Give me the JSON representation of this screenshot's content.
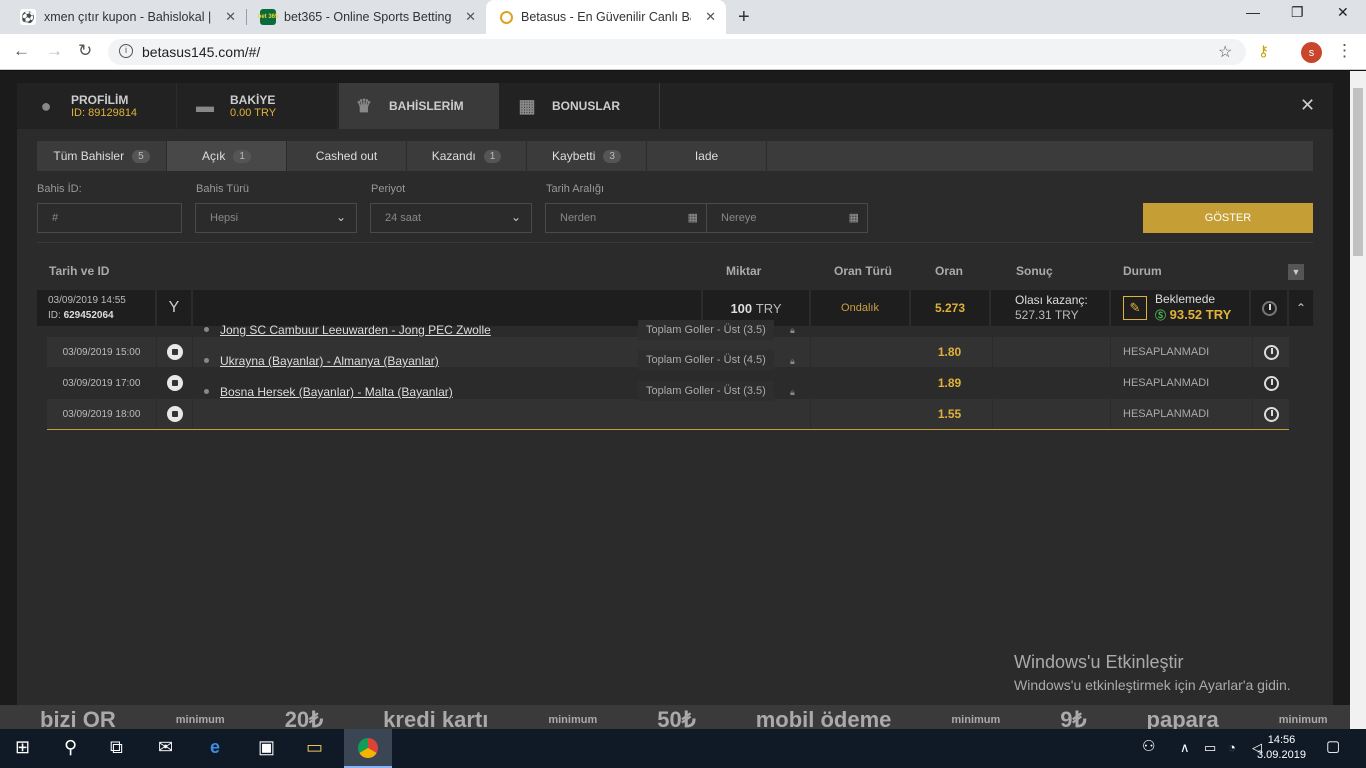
{
  "browser": {
    "tabs": [
      {
        "title": "xmen çıtır kupon - Bahislokal | Ba",
        "icon": "soccer-ball-icon"
      },
      {
        "title": "bet365 - Online Sports Betting",
        "icon": "bet365-icon",
        "badge": "bet 365"
      },
      {
        "title": "Betasus - En Güvenilir Canlı Bahis",
        "icon": "betasus-icon",
        "active": true
      }
    ],
    "url": "betasus145.com/#/",
    "avatar_letter": "s"
  },
  "modal": {
    "tabs": {
      "profile": {
        "label": "PROFİLİM",
        "sub": "ID: 89129814"
      },
      "balance": {
        "label": "BAKİYE",
        "sub": "0.00 TRY"
      },
      "bets": {
        "label": "BAHİSLERİM"
      },
      "bonus": {
        "label": "BONUSLAR"
      }
    },
    "filter_tabs": [
      {
        "label": "Tüm Bahisler",
        "count": "5"
      },
      {
        "label": "Açık",
        "count": "1"
      },
      {
        "label": "Cashed out",
        "count": ""
      },
      {
        "label": "Kazandı",
        "count": "1"
      },
      {
        "label": "Kaybetti",
        "count": "3"
      },
      {
        "label": "Iade",
        "count": ""
      }
    ],
    "filters": {
      "bet_id_label": "Bahis İD:",
      "bet_id_placeholder": "#",
      "bet_type_label": "Bahis Türü",
      "bet_type_value": "Hepsi",
      "period_label": "Periyot",
      "period_value": "24 saat",
      "date_range_label": "Tarih Aralığı",
      "from_placeholder": "Nerden",
      "to_placeholder": "Nereye",
      "show_button": "GÖSTER"
    },
    "table": {
      "headers": {
        "date_id": "Tarih ve ID",
        "amount": "Miktar",
        "odds_type": "Oran Türü",
        "odds": "Oran",
        "result": "Sonuç",
        "status": "Durum"
      },
      "bet": {
        "date": "03/09/2019 14:55",
        "id_label": "ID:",
        "id": "629452064",
        "amount": "100",
        "currency": "TRY",
        "odds_type": "Ondalık",
        "odds": "5.273",
        "possible_win_label": "Olası kazanç:",
        "possible_win": "527.31 TRY",
        "status": "Beklemede",
        "status_amount": "93.52 TRY"
      },
      "selections": [
        {
          "date": "03/09/2019 15:00",
          "match": "Jong SC Cambuur Leeuwarden - Jong PEC Zwolle",
          "market": "Toplam Goller - Üst (3.5)",
          "odds": "1.80",
          "status": "HESAPLANMADI"
        },
        {
          "date": "03/09/2019 17:00",
          "match": "Ukrayna (Bayanlar) - Almanya (Bayanlar)",
          "market": "Toplam Goller - Üst (4.5)",
          "odds": "1.89",
          "status": "HESAPLANMADI"
        },
        {
          "date": "03/09/2019 18:00",
          "match": "Bosna Hersek (Bayanlar) - Malta (Bayanlar)",
          "market": "Toplam Goller - Üst (3.5)",
          "odds": "1.55",
          "status": "HESAPLANMADI"
        }
      ]
    }
  },
  "background_banner": [
    "bizi OR",
    "minimum",
    "20₺",
    "kredi kartı",
    "minimum",
    "50₺",
    "mobil ödeme",
    "minimum",
    "9₺",
    "papara",
    "minimum"
  ],
  "watermark": {
    "title": "Windows'u Etkinleştir",
    "subtitle": "Windows'u etkinleştirmek için Ayarlar'a gidin."
  },
  "taskbar": {
    "time": "14:56",
    "date": "3.09.2019"
  }
}
